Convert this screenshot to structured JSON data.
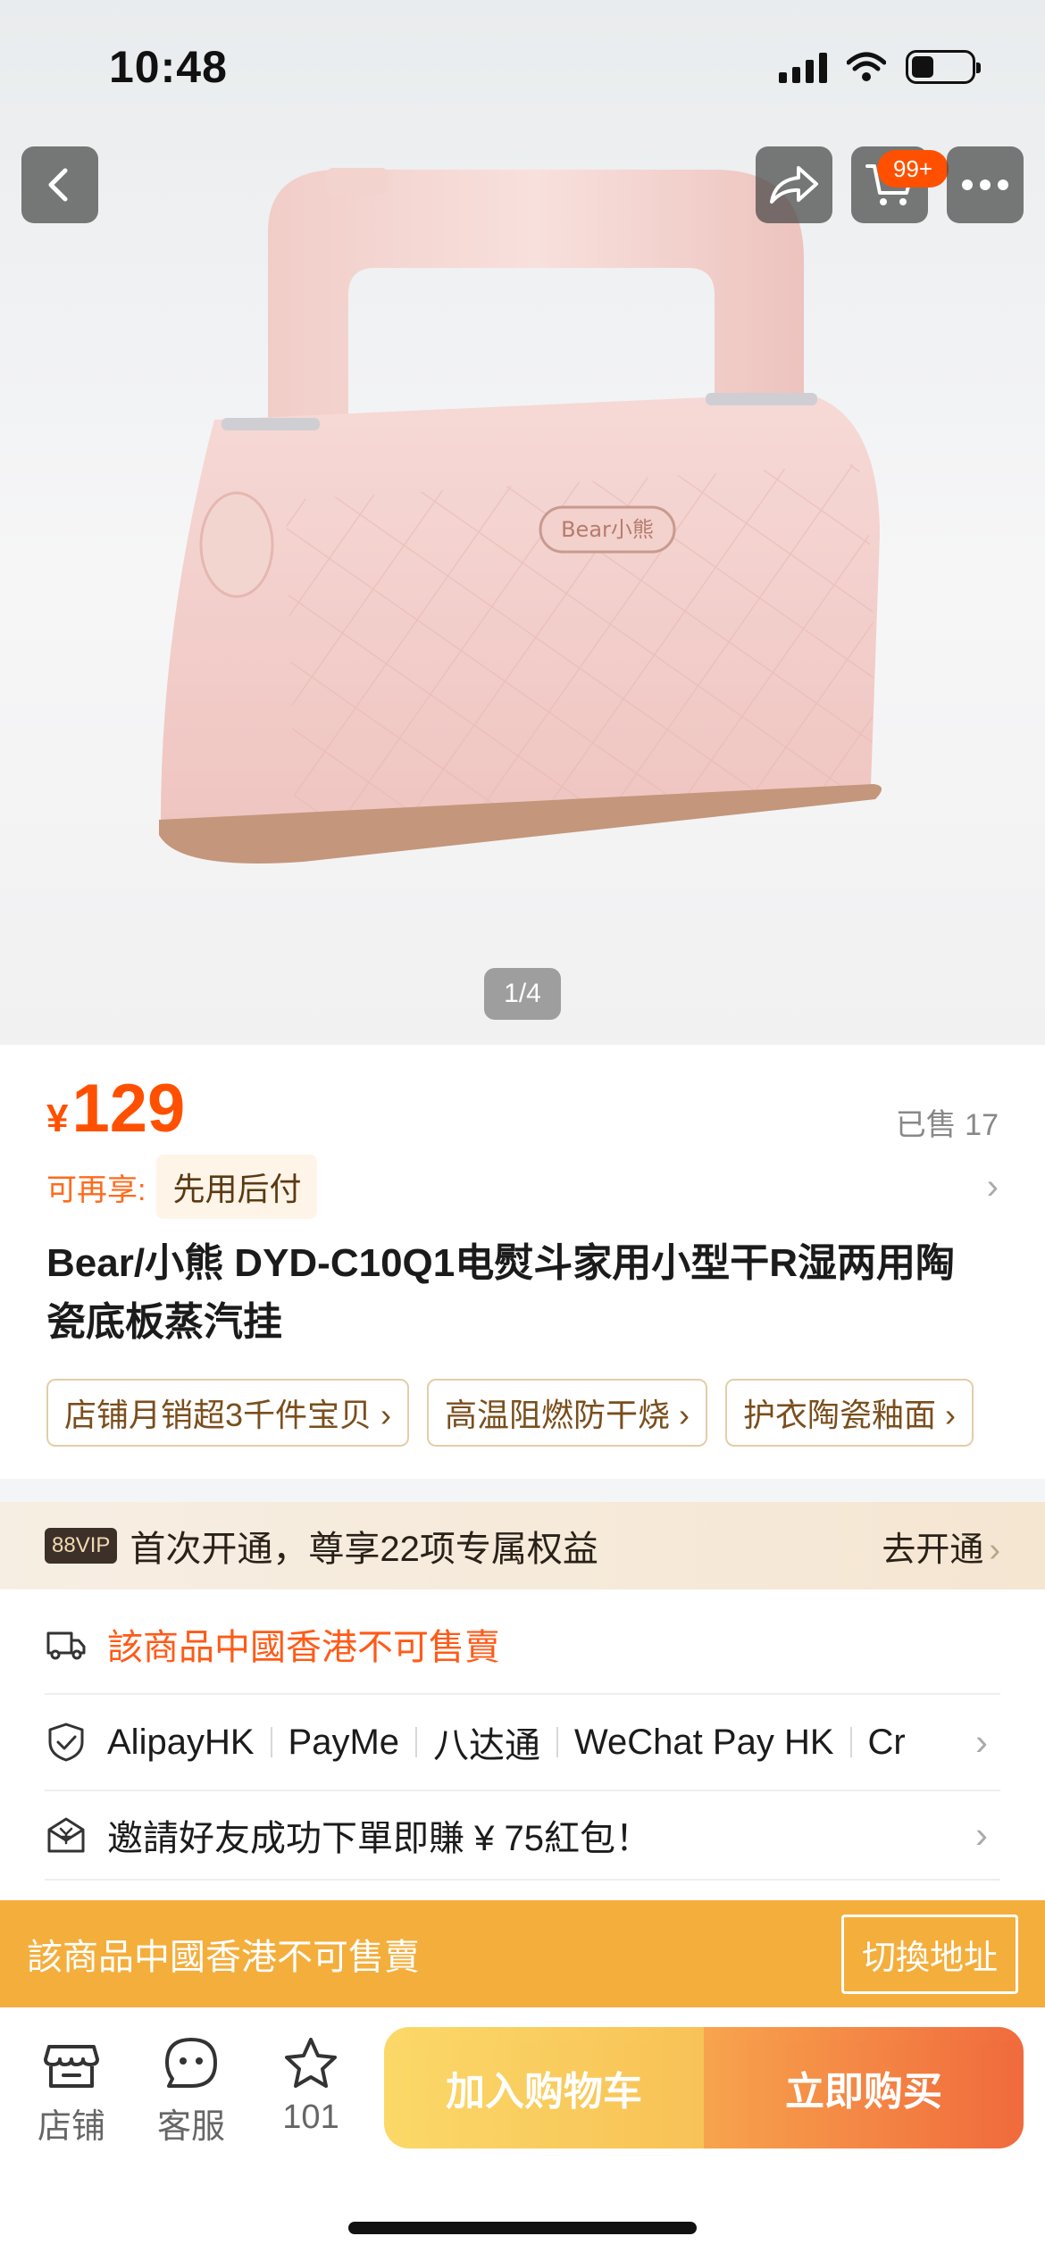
{
  "status_bar": {
    "time": "10:48"
  },
  "gallery": {
    "counter": "1/4",
    "brand_logo": "Bear小熊"
  },
  "header": {
    "cart_badge": "99+"
  },
  "icons": {
    "back": "chevron-left-icon",
    "share": "share-icon",
    "cart": "cart-icon",
    "more": "more-icon",
    "shipping": "truck-icon",
    "payment": "shield-check-icon",
    "invite": "envelope-gift-icon",
    "store": "store-icon",
    "service": "chat-face-icon",
    "favorite": "star-icon"
  },
  "product": {
    "price_currency": "¥",
    "price": "129",
    "sold": "已售 17",
    "promo_label": "可再享:",
    "promo_tag": "先用后付",
    "title": "Bear/小熊 DYD-C10Q1电熨斗家用小型干R湿两用陶瓷底板蒸汽挂",
    "tags": [
      "店铺月销超3千件宝贝 ›",
      "高温阻燃防干烧 ›",
      "护衣陶瓷釉面 ›"
    ]
  },
  "vip": {
    "badge": "88VIP",
    "text": "首次开通，尊享22项专属权益",
    "cta": "去开通"
  },
  "shipping": {
    "text": "該商品中國香港不可售賣"
  },
  "payment": {
    "methods": [
      "AlipayHK",
      "PayMe",
      "八达通",
      "WeChat Pay HK",
      "Cr"
    ]
  },
  "invite": {
    "text": "邀請好友成功下單即賺 ¥ 75紅包！"
  },
  "warning": {
    "text": "該商品中國香港不可售賣",
    "button": "切換地址"
  },
  "bottom_bar": {
    "store": "店铺",
    "service": "客服",
    "favorites": "101",
    "add_to_cart": "加入购物车",
    "buy_now": "立即购买"
  },
  "colors": {
    "accent": "#ff5000",
    "warning_bg": "#f4ae3c",
    "vip_bg": "#f7eee3"
  }
}
